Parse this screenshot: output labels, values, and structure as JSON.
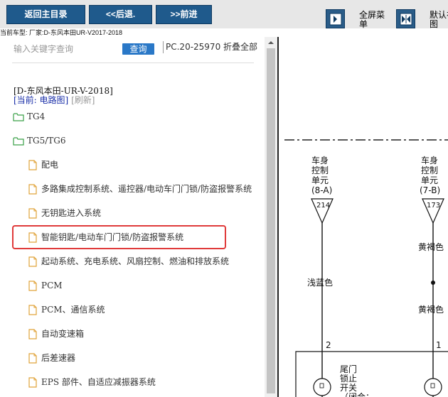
{
  "toolbar": {
    "home_label": "返回主目录",
    "back_label": "<<后退.",
    "forward_label": ">>前进",
    "fullscreen_label": "全屏菜单",
    "default_view_label": "默认视图"
  },
  "car_info": "当前车型:  厂家:D-东风本田UR-V2017-2018",
  "search": {
    "placeholder": "输入关键字查询",
    "button_label": "查询",
    "pc_text": "PC.20-25970 折叠全部"
  },
  "meta": {
    "model": "[D-东风本田-UR-V-2018]",
    "current": "[当前: 电路图]",
    "refresh": "[刷新]"
  },
  "tree": [
    {
      "label": "TG4",
      "type": "folder"
    },
    {
      "label": "TG5/TG6",
      "type": "folder"
    },
    {
      "label": "配电",
      "type": "leaf"
    },
    {
      "label": "多路集成控制系统、遥控器/电动车门门锁/防盗报警系统",
      "type": "leaf"
    },
    {
      "label": "无钥匙进入系统",
      "type": "leaf"
    },
    {
      "label": "智能钥匙/电动车门门锁/防盗报警系统",
      "type": "leaf",
      "highlighted": true
    },
    {
      "label": "起动系统、充电系统、风扇控制、燃油和排放系统",
      "type": "leaf"
    },
    {
      "label": "PCM",
      "type": "leaf"
    },
    {
      "label": "PCM、通信系统",
      "type": "leaf"
    },
    {
      "label": "自动变速箱",
      "type": "leaf"
    },
    {
      "label": "后差速器",
      "type": "leaf"
    },
    {
      "label": "EPS 部件、自适应减振器系统",
      "type": "leaf"
    }
  ],
  "diagram": {
    "left_unit": [
      "车身",
      "控制",
      "单元",
      "(8-A)"
    ],
    "left_pin": "214",
    "left_wire": "浅蓝色",
    "left_terminal": "2",
    "right_unit": [
      "车身",
      "控制",
      "单元",
      "(7-B)"
    ],
    "right_pin": "173",
    "right_wire_top": "黄褐色",
    "right_wire_bottom": "黄褐色",
    "right_terminal": "1",
    "switch_label": [
      "尾门",
      "锁止",
      "开关",
      "（闭合："
    ]
  },
  "colors": {
    "toolbar_button": "#1f5a8c",
    "search_button": "#2a78c7",
    "highlight_border": "#e03a3a",
    "current_text": "#1a2fa8"
  }
}
